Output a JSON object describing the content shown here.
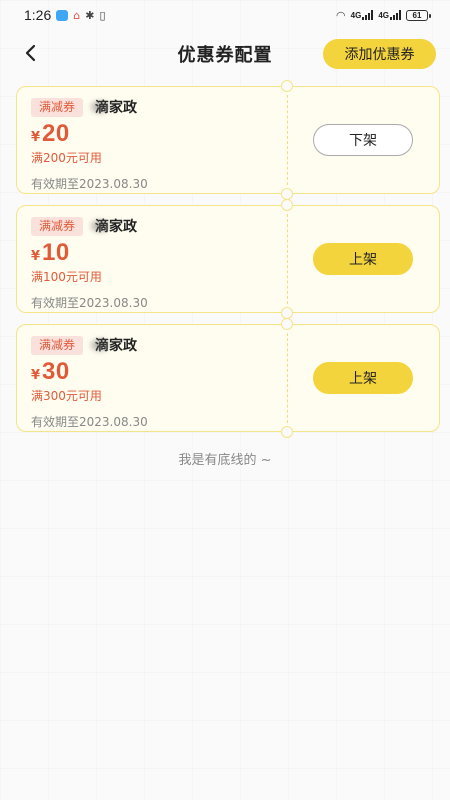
{
  "status_bar": {
    "time": "1:26",
    "battery": "61",
    "signal1": "4G",
    "signal2": "4G"
  },
  "header": {
    "title": "优惠券配置",
    "add_button": "添加优惠券"
  },
  "coupons": [
    {
      "tag": "满减券",
      "shop": "滴家政",
      "currency": "¥",
      "amount": "20",
      "condition": "满200元可用",
      "expiry": "有效期至2023.08.30",
      "action": "下架",
      "state": "off"
    },
    {
      "tag": "满减券",
      "shop": "滴家政",
      "currency": "¥",
      "amount": "10",
      "condition": "满100元可用",
      "expiry": "有效期至2023.08.30",
      "action": "上架",
      "state": "on"
    },
    {
      "tag": "满减券",
      "shop": "滴家政",
      "currency": "¥",
      "amount": "30",
      "condition": "满300元可用",
      "expiry": "有效期至2023.08.30",
      "action": "上架",
      "state": "on"
    }
  ],
  "footer": "我是有底线的 ~",
  "colors": {
    "accent": "#f4d43d",
    "price_red": "#e05a3a",
    "card_bg": "#fffdf0",
    "card_border": "#f6e48a"
  }
}
